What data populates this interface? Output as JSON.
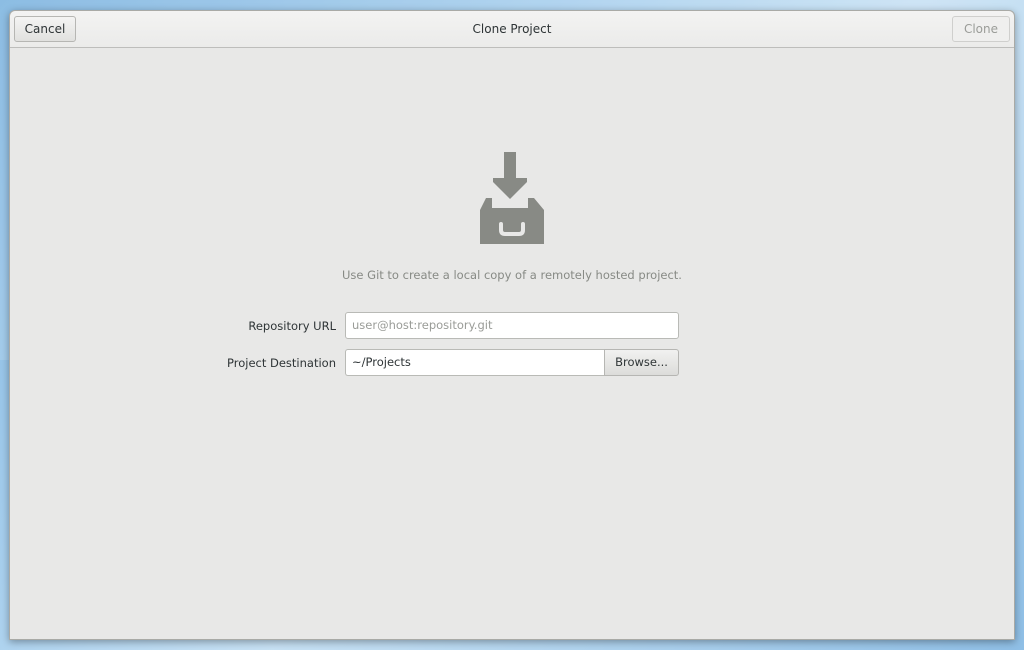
{
  "window": {
    "title": "Clone Project"
  },
  "headerbar": {
    "cancel_label": "Cancel",
    "clone_label": "Clone"
  },
  "hero": {
    "icon": "download-tray-icon",
    "description": "Use Git to create a local copy of a remotely hosted project."
  },
  "form": {
    "repository_url": {
      "label": "Repository URL",
      "value": "",
      "placeholder": "user@host:repository.git"
    },
    "project_destination": {
      "label": "Project Destination",
      "value": "~/Projects",
      "browse_label": "Browse..."
    }
  },
  "colors": {
    "window_bg": "#e8e8e7",
    "icon": "#888a85",
    "text": "#2e3436",
    "muted_text": "#878a85"
  }
}
